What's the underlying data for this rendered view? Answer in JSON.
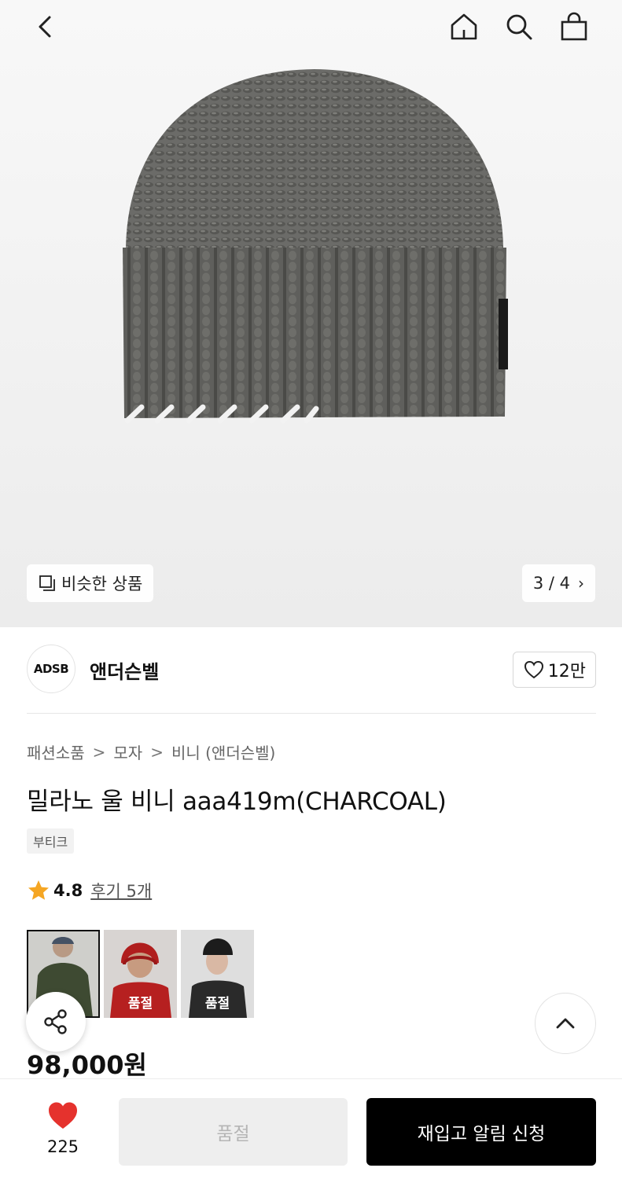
{
  "pager": {
    "text": "3 / 4",
    "chevron": "›"
  },
  "similar": {
    "label": "비슷한 상품"
  },
  "brand": {
    "logo_text": "ADSB",
    "name": "앤더슨벨",
    "like_count": "12만"
  },
  "breadcrumb": {
    "items": [
      "패션소품",
      "모자",
      "비니 (앤더슨벨)"
    ],
    "separator": ">"
  },
  "product": {
    "title": "밀라노 울 비니 aaa419m(CHARCOAL)",
    "tag": "부티크",
    "rating": "4.8",
    "reviews": "후기 5개",
    "price": "98,000원"
  },
  "thumbs": {
    "soldout_label": "품절"
  },
  "bottom": {
    "wish_count": "225",
    "soldout_label": "품절",
    "restock_label": "재입고 알림 신청"
  },
  "colors": {
    "heart_red": "#e5322d",
    "star": "#f5a623",
    "restock_bg": "#000000",
    "soldout_bg": "#eeeeee"
  },
  "icons": [
    "back-icon",
    "home-icon",
    "search-icon",
    "shopping-bag-icon",
    "similar-items-icon",
    "heart-outline-icon",
    "star-icon",
    "share-icon",
    "chevron-up-icon",
    "heart-filled-icon"
  ]
}
